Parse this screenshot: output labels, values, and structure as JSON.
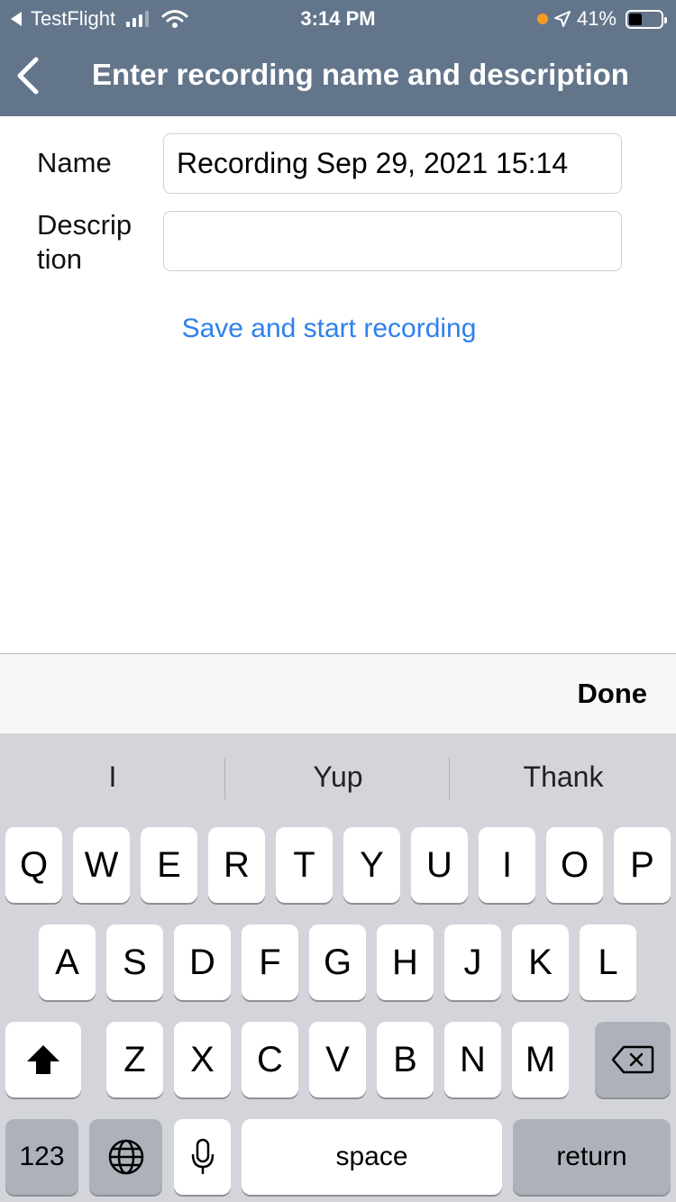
{
  "status_bar": {
    "back_app": "TestFlight",
    "time": "3:14 PM",
    "battery": "41%",
    "battery_level": 0.41
  },
  "nav": {
    "title": "Enter recording name and description"
  },
  "form": {
    "name_label": "Name",
    "name_value": "Recording Sep 29, 2021 15:14",
    "description_label_line1": "Descrip",
    "description_label_line2": "tion",
    "description_value": "",
    "save_label": "Save and start recording"
  },
  "accessory": {
    "done_label": "Done"
  },
  "keyboard": {
    "predictions": [
      "I",
      "Yup",
      "Thank"
    ],
    "row1": [
      "Q",
      "W",
      "E",
      "R",
      "T",
      "Y",
      "U",
      "I",
      "O",
      "P"
    ],
    "row2": [
      "A",
      "S",
      "D",
      "F",
      "G",
      "H",
      "J",
      "K",
      "L"
    ],
    "row3": [
      "Z",
      "X",
      "C",
      "V",
      "B",
      "N",
      "M"
    ],
    "numbers_label": "123",
    "space_label": "space",
    "return_label": "return"
  },
  "colors": {
    "nav_bg": "#63758a",
    "link": "#2f80ed",
    "keyboard_bg": "#d3d5db"
  }
}
